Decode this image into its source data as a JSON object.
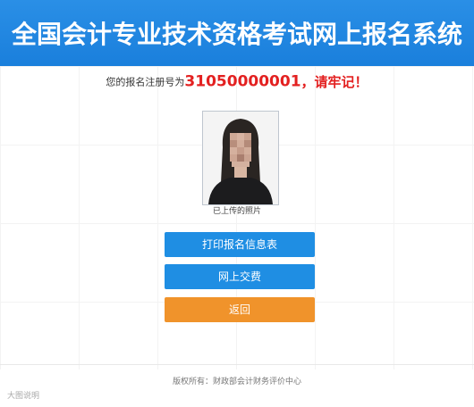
{
  "header": {
    "title": "全国会计专业技术资格考试网上报名系统",
    "color": "#1a7fdc"
  },
  "registration": {
    "prefix": "您的报名注册号为",
    "number": "31050000001",
    "suffix": "，请牢记！",
    "highlight_color": "#e32020"
  },
  "photo": {
    "caption": "已上传的照片"
  },
  "buttons": {
    "print_label": "打印报名信息表",
    "pay_label": "网上交费",
    "back_label": "返回",
    "primary_color": "#1f8ee3",
    "back_color": "#f0932b"
  },
  "footer": {
    "text": "版权所有：财政部会计财务评价中心"
  },
  "watermark": {
    "text": "大图说明"
  }
}
